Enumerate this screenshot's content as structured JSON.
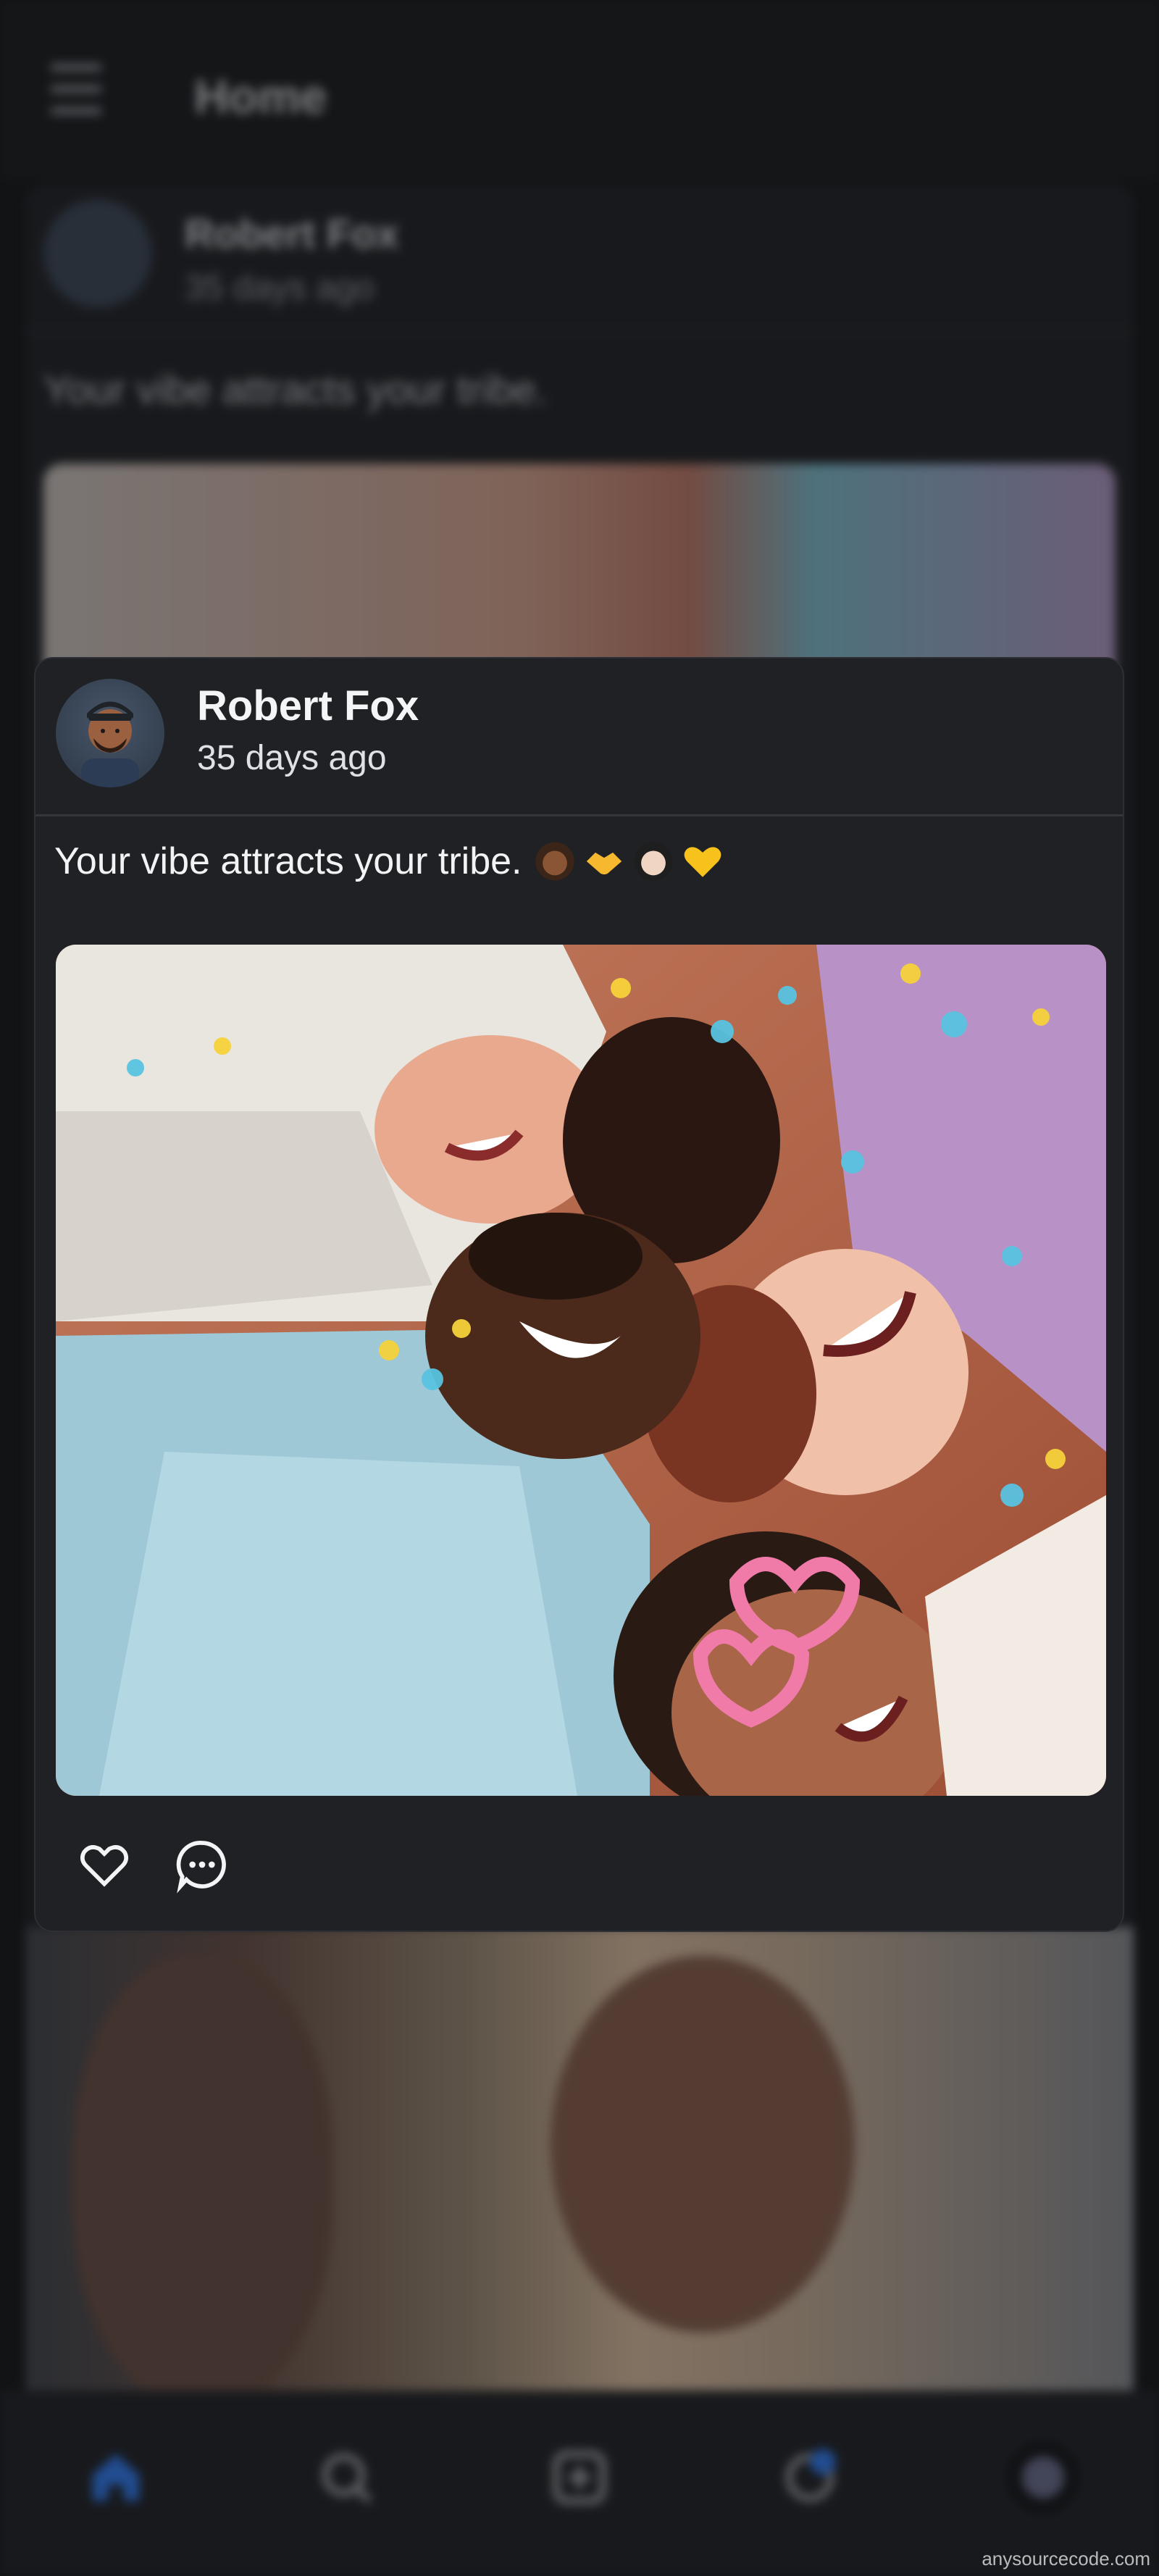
{
  "app": {
    "header_title": "Home",
    "menu_icon": "hamburger-menu-icon"
  },
  "background_post": {
    "author": "Robert Fox",
    "time": "35 days ago",
    "caption": "Your vibe attracts your tribe."
  },
  "post": {
    "author": "Robert Fox",
    "time": "35 days ago",
    "caption": "Your vibe attracts your tribe.",
    "caption_emojis": [
      "medium-dark-skin-woman-emoji",
      "handshake-emoji",
      "light-skin-person-emoji",
      "yellow-heart-emoji"
    ],
    "image": "group-of-friends-laughing-with-confetti-photo",
    "actions": [
      {
        "name": "like",
        "icon": "heart-icon"
      },
      {
        "name": "comment",
        "icon": "comment-dots-icon"
      }
    ]
  },
  "bottom_nav": {
    "items": [
      {
        "name": "home",
        "icon": "home-icon",
        "active": true
      },
      {
        "name": "search",
        "icon": "search-icon"
      },
      {
        "name": "create",
        "icon": "add-square-icon"
      },
      {
        "name": "notifications",
        "icon": "notification-icon"
      },
      {
        "name": "profile",
        "icon": "profile-avatar-icon"
      }
    ]
  },
  "colors": {
    "background": "#121315",
    "card": "#1f2124",
    "accent": "#3b82f6",
    "text": "#f4f5f6"
  },
  "watermark": "anysourcecode.com"
}
